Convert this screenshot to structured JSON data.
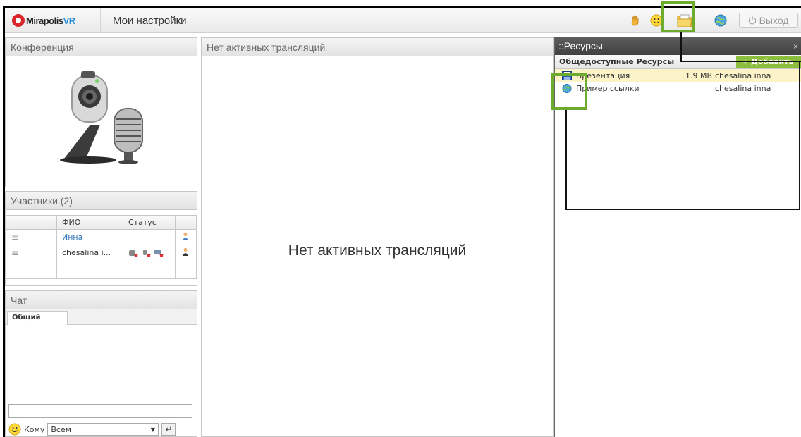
{
  "header": {
    "logo_text": "Mirapolis",
    "logo_suffix": "VR",
    "settings_link": "Мои настройки",
    "exit_label": "Выход",
    "icons": [
      "hand-icon",
      "smile-icon",
      "folder-icon",
      "globe-icon"
    ]
  },
  "conference": {
    "title": "Конференция"
  },
  "participants": {
    "title": "Участники (2)",
    "columns": [
      "ФИО",
      "Статус"
    ],
    "rows": [
      {
        "name": "Инна"
      },
      {
        "name": "chesalina i..."
      }
    ]
  },
  "chat": {
    "title": "Чат",
    "tab": "Общий",
    "input_value": "",
    "to_label": "Кому",
    "to_value": "Всем"
  },
  "broadcast": {
    "title": "Нет активных трансляций",
    "message": "Нет активных трансляций"
  },
  "resources": {
    "title": "Ресурсы",
    "title_prefix": "::",
    "close": "×",
    "subheader": "Общедоступные Ресурсы",
    "add_button": "+ Добавить",
    "items": [
      {
        "name": "Презентация",
        "size": "1.9 MB",
        "owner": "chesalina inna",
        "icon": "disk-icon"
      },
      {
        "name": "Пример ссылки",
        "size": "",
        "owner": "chesalina inna",
        "icon": "globe-link-icon"
      }
    ]
  },
  "colors": {
    "highlight": "#6cab2e",
    "link": "#2b72b8",
    "add_button": "#8cbd3c",
    "selected_row": "#fdf3c8"
  }
}
